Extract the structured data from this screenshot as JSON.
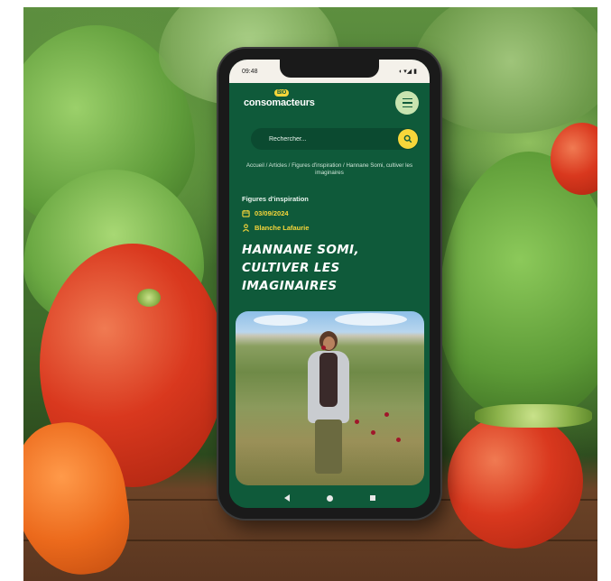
{
  "status_bar": {
    "time": "09:48",
    "icons": "◖ ▾◢ ▮"
  },
  "header": {
    "logo_badge": "BIO",
    "logo_text": "consomacteurs",
    "menu_icon": "hamburger-icon"
  },
  "search": {
    "placeholder": "Rechercher...",
    "icon": "search-icon"
  },
  "breadcrumb": "Accueil / Articles / Figures d'inspiration / Hannane Somi, cultiver les imaginaires",
  "article": {
    "category": "Figures d'inspiration",
    "date": "03/09/2024",
    "author": "Blanche Lafaurie",
    "title": "Hannane Somi, cultiver les imaginaires"
  },
  "nav": {
    "back_icon": "back-triangle-icon",
    "home_icon": "home-circle-icon",
    "recent_icon": "recents-square-icon"
  },
  "colors": {
    "brand_green": "#0f5a3a",
    "accent_yellow": "#f7d63a",
    "menu_bg": "#c8e4b0"
  }
}
